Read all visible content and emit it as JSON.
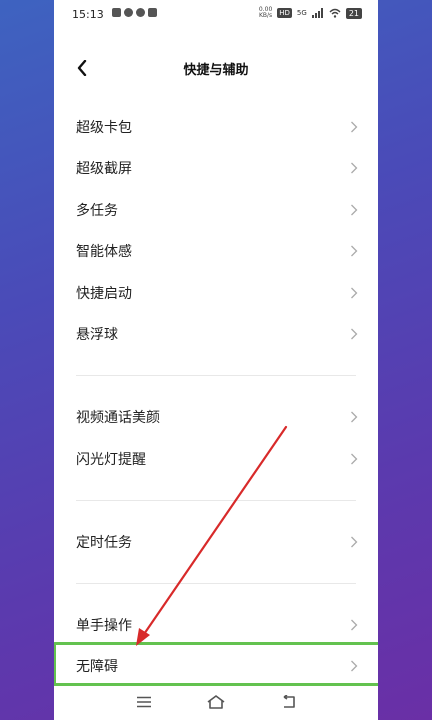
{
  "status_bar": {
    "time": "15:13",
    "speed_value": "0.00",
    "speed_unit": "KB/s",
    "hd_badge": "HD",
    "network": "5G",
    "battery": "21"
  },
  "header": {
    "title": "快捷与辅助"
  },
  "menu": {
    "group1": [
      {
        "label": "超级卡包"
      },
      {
        "label": "超级截屏"
      },
      {
        "label": "多任务"
      },
      {
        "label": "智能体感"
      },
      {
        "label": "快捷启动"
      },
      {
        "label": "悬浮球"
      }
    ],
    "group2": [
      {
        "label": "视频通话美颜"
      },
      {
        "label": "闪光灯提醒"
      }
    ],
    "group3": [
      {
        "label": "定时任务"
      }
    ],
    "group4": [
      {
        "label": "单手操作"
      },
      {
        "label": "无障碍"
      }
    ]
  },
  "colors": {
    "highlight": "#63c24f",
    "arrow": "#d82a2a"
  },
  "icons": {
    "back": "chevron-left-icon",
    "row": "chevron-right-icon",
    "nav_menu": "menu-icon",
    "nav_home": "home-icon",
    "nav_back": "back-icon"
  }
}
